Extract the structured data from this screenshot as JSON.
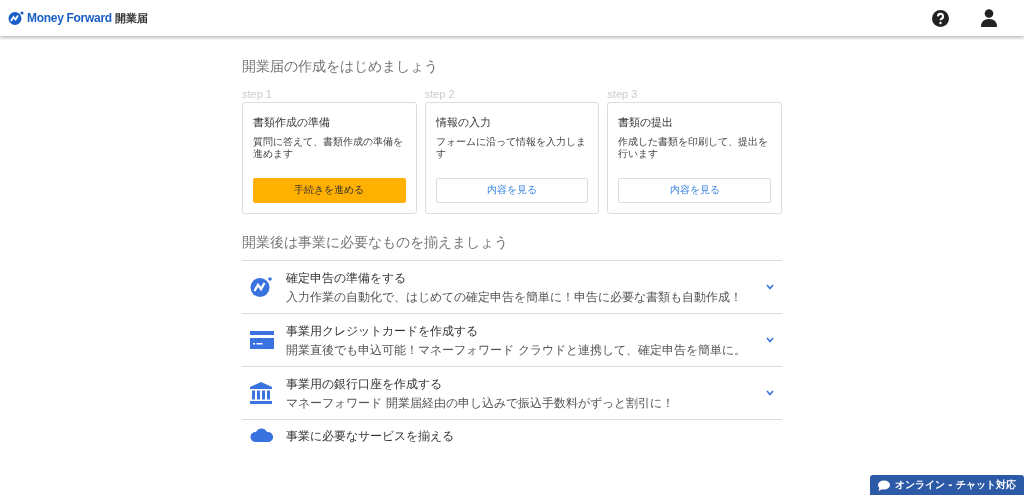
{
  "header": {
    "logo_text": "Money Forward",
    "product": "開業届"
  },
  "intro": {
    "heading": "開業届の作成をはじめましょう"
  },
  "steps": [
    {
      "step": "step 1",
      "title": "書類作成の準備",
      "description": "質問に答えて、書類作成の準備を進めます",
      "button": "手続きを進める",
      "selected": true
    },
    {
      "step": "step 2",
      "title": "情報の入力",
      "description": "フォームに沿って情報を入力します",
      "button": "内容を見る",
      "selected": false
    },
    {
      "step": "step 3",
      "title": "書類の提出",
      "description": "作成した書類を印刷して、提出を行います",
      "button": "内容を見る",
      "selected": false
    }
  ],
  "services": {
    "heading": "開業後は事業に必要なものを揃えましょう",
    "items": [
      {
        "kind": "tax",
        "title": "確定申告の準備をする",
        "description": "入力作業の自動化で、はじめての確定申告を簡単に！申告に必要な書類も自動作成！"
      },
      {
        "kind": "card",
        "title": "事業用クレジットカードを作成する",
        "description": "開業直後でも申込可能！マネーフォワード クラウドと連携して、確定申告を簡単に。"
      },
      {
        "kind": "bank",
        "title": "事業用の銀行口座を作成する",
        "description": "マネーフォワード 開業届経由の申し込みで振込手数料がずっと割引に！"
      },
      {
        "kind": "cloud",
        "title": "事業に必要なサービスを揃える"
      }
    ]
  },
  "chat_button": "オンライン - チャット対応"
}
